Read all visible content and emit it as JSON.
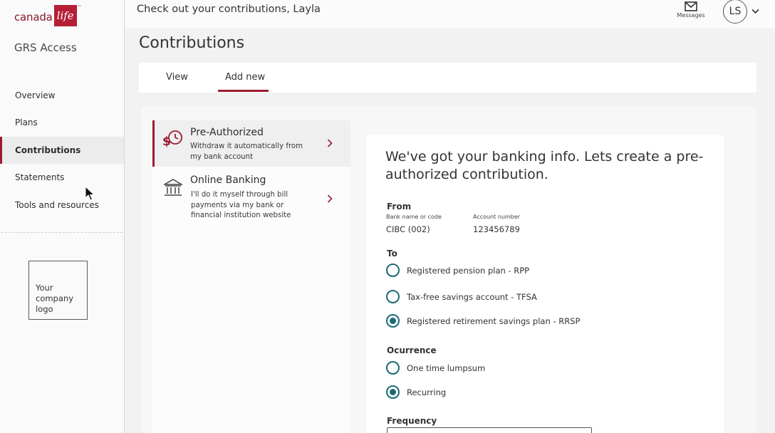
{
  "brand": {
    "word": "canada",
    "box": "life",
    "tm": "™",
    "app_name": "GRS Access"
  },
  "sidebar": {
    "items": [
      {
        "label": "Overview"
      },
      {
        "label": "Plans"
      },
      {
        "label": "Contributions"
      },
      {
        "label": "Statements"
      },
      {
        "label": "Tools and resources"
      }
    ],
    "active_index": 2,
    "company_logo_text": [
      "Your",
      "company",
      "logo"
    ]
  },
  "header": {
    "greeting": "Check out your contributions, Layla",
    "messages_label": "Messages",
    "avatar_initials": "LS"
  },
  "page": {
    "title": "Contributions"
  },
  "tabs": [
    {
      "label": "View",
      "active": false
    },
    {
      "label": "Add new",
      "active": true
    }
  ],
  "methods": [
    {
      "title": "Pre-Authorized",
      "desc_lines": [
        "Withdraw it automatically from",
        "my bank account"
      ],
      "selected": true
    },
    {
      "title": "Online Banking",
      "desc_lines": [
        "I'll do it myself through bill",
        "payments via my bank or",
        "financial institution website"
      ],
      "selected": false
    }
  ],
  "form": {
    "heading": "We've got your banking info. Lets create a pre-authorized contribution.",
    "from": {
      "label": "From",
      "bank_label": "Bank name or code",
      "bank_value": "CIBC (002)",
      "account_label": "Account number",
      "account_value": "123456789"
    },
    "to": {
      "label": "To",
      "options": [
        {
          "label": "Registered pension plan - RPP",
          "selected": false
        },
        {
          "label": "Tax-free savings account - TFSA",
          "selected": false
        },
        {
          "label": "Registered  retirement savings plan - RRSP",
          "selected": true
        }
      ]
    },
    "occurrence": {
      "label": "Ocurrence",
      "options": [
        {
          "label": "One time lumpsum",
          "selected": false
        },
        {
          "label": "Recurring",
          "selected": true
        }
      ]
    },
    "frequency": {
      "label": "Frequency",
      "value": ""
    }
  },
  "colors": {
    "accent": "#9c1c32",
    "brand_red": "#b51f35",
    "radio": "#1b6b74"
  }
}
